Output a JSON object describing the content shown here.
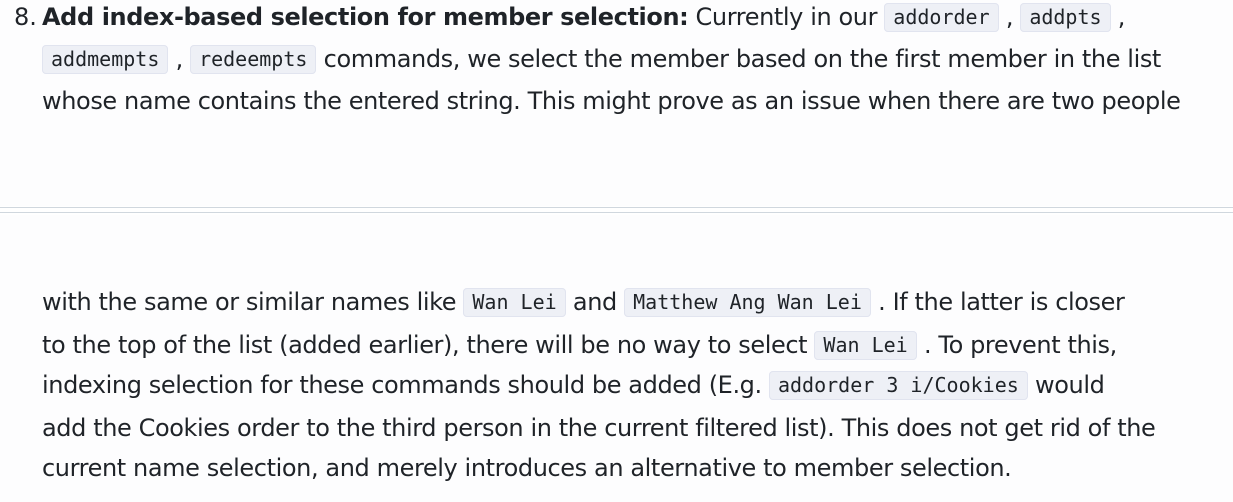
{
  "item": {
    "number": "8.",
    "heading": "Add index-based selection for member selection:",
    "top_text": {
      "t1": " Currently in our ",
      "c1": "addorder",
      "t2": " , ",
      "c2": "addpts",
      "t3": " ,",
      "c3": "addmempts",
      "t4": " , ",
      "c4": "redeempts",
      "t5": " commands, we select the member based on the first member in the list",
      "t6": "whose name contains the entered string. This might prove as an issue when there are two people"
    },
    "bottom_text": {
      "t1": "with the same or similar names like ",
      "c1": "Wan Lei",
      "t2": " and ",
      "c2": "Matthew Ang Wan Lei",
      "t3": " . If the latter is closer",
      "t4": "to the top of the list (added earlier), there will be no way to select ",
      "c3": "Wan Lei",
      "t5": " . To prevent this,",
      "t6": "indexing selection for these commands should be added (E.g. ",
      "c4": "addorder 3 i/Cookies",
      "t7": " would",
      "t8": "add the Cookies order to the third person in the current filtered list). This does not get rid of the",
      "t9": "current name selection, and merely introduces an alternative to member selection."
    }
  }
}
